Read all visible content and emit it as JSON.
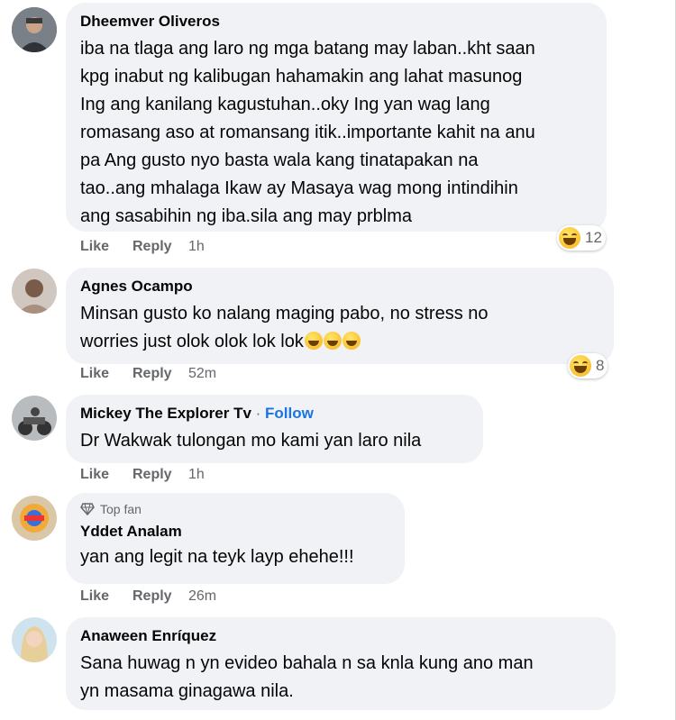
{
  "comments": [
    {
      "author": "Dheemver Oliveros",
      "lines": [
        "iba na tlaga ang laro ng mga batang may laban..kht saan",
        "kpg inabut ng kalibugan hahamakin ang lahat masunog",
        "Ing ang kanilang kagustuhan..oky Ing yan wag lang",
        "romasang aso at romansang itik..importante kahit na anu",
        "pa Ang gusto nyo basta wala kang tinatapakan na",
        "tao..ang mhalaga Ikaw ay Masaya wag mong intindihin",
        "ang sasabihin ng iba.sila ang may prblma"
      ],
      "like": "Like",
      "reply": "Reply",
      "time": "1h",
      "reaction_icon": "laughing-emoji",
      "reaction_count": "12"
    },
    {
      "author": "Agnes Ocampo",
      "lines": [
        "Minsan gusto ko nalang maging pabo, no stress no",
        "worries just olok olok lok lok"
      ],
      "like": "Like",
      "reply": "Reply",
      "time": "52m",
      "reaction_icon": "laughing-emoji",
      "reaction_count": "8"
    },
    {
      "author": "Mickey The Explorer Tv",
      "separator": " · ",
      "follow": "Follow",
      "lines": [
        "Dr Wakwak tulongan mo kami yan laro nila"
      ],
      "like": "Like",
      "reply": "Reply",
      "time": "1h"
    },
    {
      "badge": "Top fan",
      "badge_icon": "diamond-icon",
      "author": "Yddet Analam",
      "lines": [
        "yan ang legit na teyk layp ehehe!!!"
      ],
      "like": "Like",
      "reply": "Reply",
      "time": "26m"
    },
    {
      "author": "Anaween Enríquez",
      "lines": [
        "Sana huwag n yn evideo bahala n sa knla kung ano man",
        "yn masama ginagawa nila."
      ]
    }
  ],
  "colors": {
    "bubble": "#f0f2f5",
    "follow": "#1b74e4",
    "meta": "#65676b"
  }
}
